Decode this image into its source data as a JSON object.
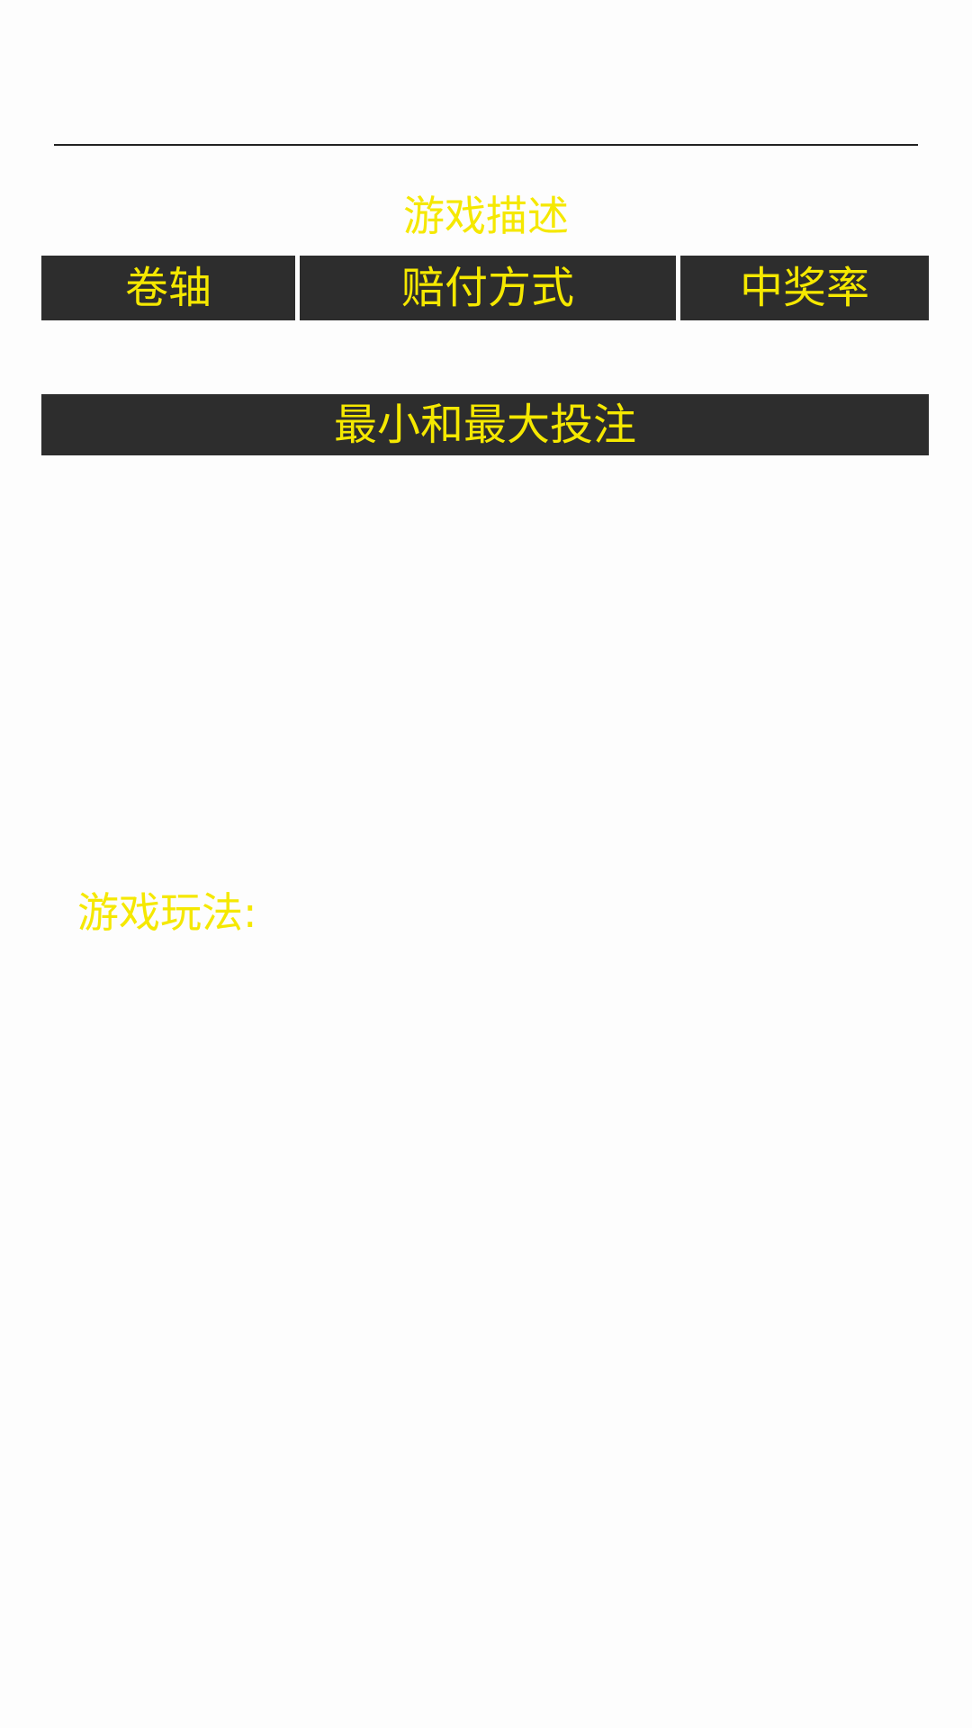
{
  "header": {
    "section_title": "游戏描述"
  },
  "tabs": [
    {
      "label": "卷轴"
    },
    {
      "label": "赔付方式"
    },
    {
      "label": "中奖率"
    }
  ],
  "bet_section": {
    "label": "最小和最大投注"
  },
  "how_to_play": {
    "heading": "游戏玩法:"
  },
  "colors": {
    "accent_text": "#f5e800",
    "bar_background": "#2d2d2d",
    "page_background": "#fdfdfd"
  }
}
